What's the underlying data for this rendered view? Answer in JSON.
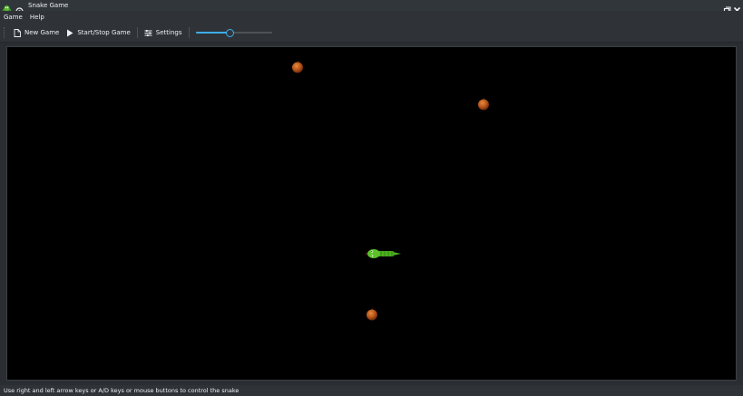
{
  "window": {
    "title": "Snake Game"
  },
  "menu": {
    "items": [
      {
        "label": "Game"
      },
      {
        "label": "Help"
      }
    ]
  },
  "toolbar": {
    "new_game_label": "New Game",
    "start_stop_label": "Start/Stop Game",
    "settings_label": "Settings",
    "speed_slider_value": 0.45
  },
  "game": {
    "apples": [
      {
        "name": "apple-1"
      },
      {
        "name": "apple-2"
      },
      {
        "name": "apple-3"
      }
    ],
    "snake_direction": "left",
    "colors": {
      "background": "#000000",
      "snake": "#4caf1f",
      "apple": "#b5531a"
    }
  },
  "statusbar": {
    "text": "Use right and left arrow keys or A/D keys or mouse buttons to control the snake"
  },
  "colors": {
    "accent": "#3daee9",
    "window_bg": "#2f3338"
  }
}
